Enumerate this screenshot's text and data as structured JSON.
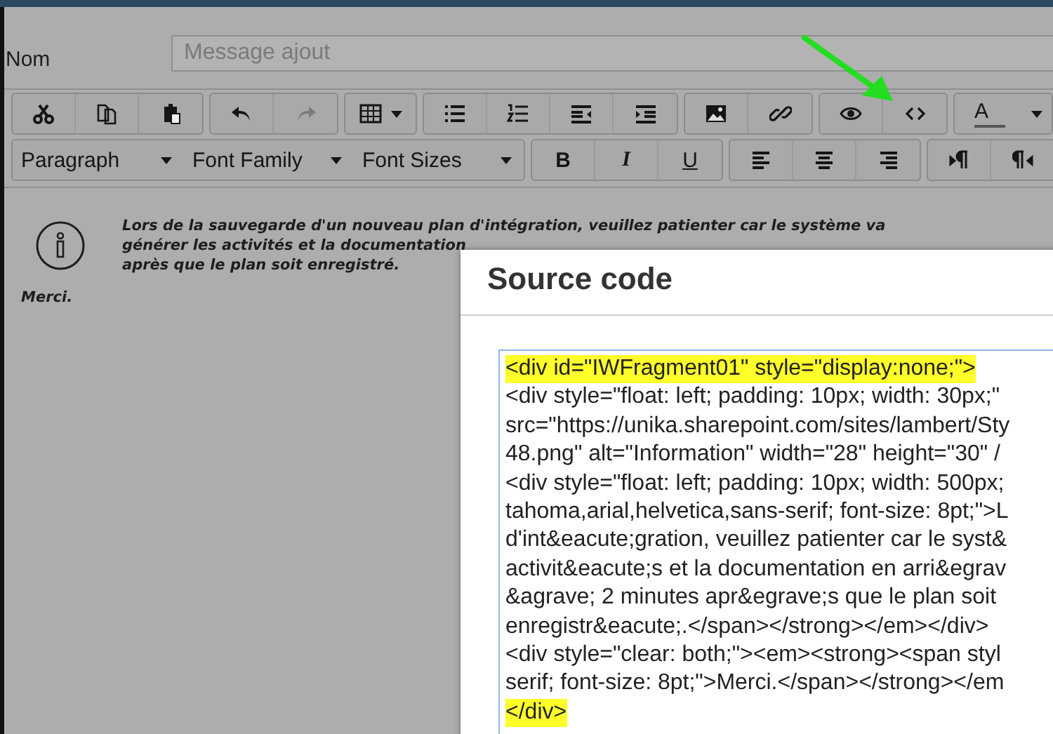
{
  "form": {
    "name_label": "Nom",
    "name_placeholder": "Message ajout"
  },
  "toolbar": {
    "row_1": [
      [
        {
          "disabled": false
        },
        {
          "disabled": false
        },
        {
          "disabled": false
        }
      ],
      [
        {
          "disabled": false
        },
        {
          "disabled": true
        }
      ],
      [
        {
          "disabled": false
        }
      ],
      [
        {
          "disabled": false
        },
        {
          "disabled": false
        },
        {
          "disabled": false
        },
        {
          "disabled": false
        }
      ],
      [
        {
          "disabled": false
        },
        {
          "disabled": false
        }
      ],
      [
        {
          "disabled": false
        },
        {
          "disabled": false
        }
      ],
      [
        {
          "disabled": false
        }
      ]
    ],
    "text_color_label": "A",
    "dropdowns": [
      "Paragraph",
      "Font Family",
      "Font Sizes"
    ],
    "format_buttons": [
      "B",
      "I",
      "U"
    ]
  },
  "content": {
    "message_lines": [
      "Lors de la sauvegarde d'un nouveau plan d'intégration, veuillez patienter car le système va",
      "générer les activités et la documentation",
      "après que le plan soit enregistré."
    ],
    "closing": "Merci."
  },
  "dialog": {
    "title": "Source code",
    "code_lines": [
      {
        "text": "<div id=\"IWFragment01\" style=\"display:none;\">",
        "highlighted": true
      },
      {
        "text": "<div style=\"float: left; padding: 10px; width: 30px;\"",
        "highlighted": false
      },
      {
        "text": "src=\"https://unika.sharepoint.com/sites/lambert/Sty",
        "highlighted": false
      },
      {
        "text": "48.png\" alt=\"Information\" width=\"28\" height=\"30\" /",
        "highlighted": false
      },
      {
        "text": "<div style=\"float: left; padding: 10px; width: 500px;",
        "highlighted": false
      },
      {
        "text": "tahoma,arial,helvetica,sans-serif; font-size: 8pt;\">L",
        "highlighted": false
      },
      {
        "text": "d'int&eacute;gration, veuillez patienter car le syst&",
        "highlighted": false
      },
      {
        "text": "activit&eacute;s et la documentation en arri&egrav",
        "highlighted": false
      },
      {
        "text": "&agrave; 2 minutes apr&egrave;s que le plan soit",
        "highlighted": false
      },
      {
        "text": "enregistr&eacute;.</span></strong></em></div>",
        "highlighted": false
      },
      {
        "text": "<div style=\"clear: both;\"><em><strong><span styl",
        "highlighted": false
      },
      {
        "text": "serif; font-size: 8pt;\">Merci.</span></strong></em",
        "highlighted": false
      },
      {
        "text": "</div>",
        "highlighted": true
      }
    ]
  }
}
